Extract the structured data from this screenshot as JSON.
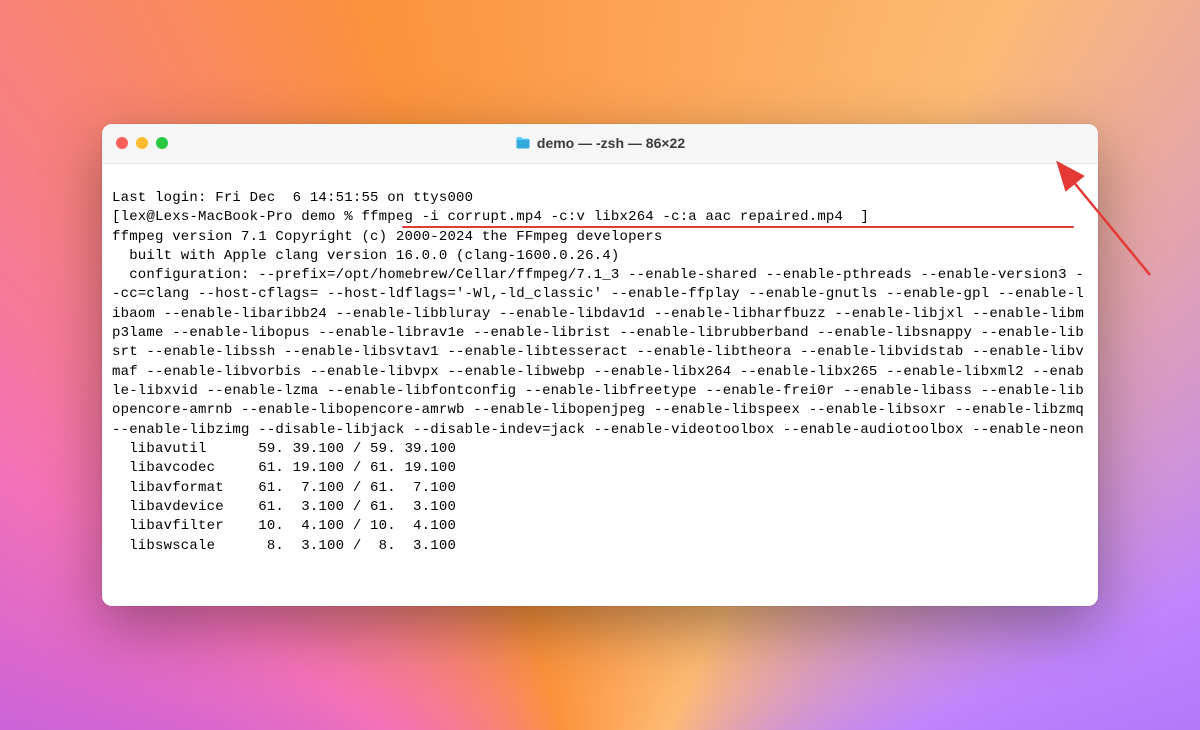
{
  "window": {
    "title": "demo — -zsh — 86×22"
  },
  "terminal": {
    "last_login": "Last login: Fri Dec  6 14:51:55 on ttys000",
    "prompt_open": "[",
    "prompt_user": "lex@Lexs-MacBook-Pro demo % ",
    "command": "ffmpeg -i corrupt.mp4 -c:v libx264 -c:a aac repaired.mp4",
    "prompt_close": "  ]",
    "ffmpeg_version": "ffmpeg version 7.1 Copyright (c) 2000-2024 the FFmpeg developers",
    "built_with": "  built with Apple clang version 16.0.0 (clang-1600.0.26.4)",
    "configuration": "  configuration: --prefix=/opt/homebrew/Cellar/ffmpeg/7.1_3 --enable-shared --enable-pthreads --enable-version3 --cc=clang --host-cflags= --host-ldflags='-Wl,-ld_classic' --enable-ffplay --enable-gnutls --enable-gpl --enable-libaom --enable-libaribb24 --enable-libbluray --enable-libdav1d --enable-libharfbuzz --enable-libjxl --enable-libmp3lame --enable-libopus --enable-librav1e --enable-librist --enable-librubberband --enable-libsnappy --enable-libsrt --enable-libssh --enable-libsvtav1 --enable-libtesseract --enable-libtheora --enable-libvidstab --enable-libvmaf --enable-libvorbis --enable-libvpx --enable-libwebp --enable-libx264 --enable-libx265 --enable-libxml2 --enable-libxvid --enable-lzma --enable-libfontconfig --enable-libfreetype --enable-frei0r --enable-libass --enable-libopencore-amrnb --enable-libopencore-amrwb --enable-libopenjpeg --enable-libspeex --enable-libsoxr --enable-libzmq --enable-libzimg --disable-libjack --disable-indev=jack --enable-videotoolbox --enable-audiotoolbox --enable-neon",
    "libs": [
      "  libavutil      59. 39.100 / 59. 39.100",
      "  libavcodec     61. 19.100 / 61. 19.100",
      "  libavformat    61.  7.100 / 61.  7.100",
      "  libavdevice    61.  3.100 / 61.  3.100",
      "  libavfilter    10.  4.100 / 10.  4.100",
      "  libswscale      8.  3.100 /  8.  3.100"
    ]
  },
  "annotation": {
    "color": "#e53935"
  }
}
